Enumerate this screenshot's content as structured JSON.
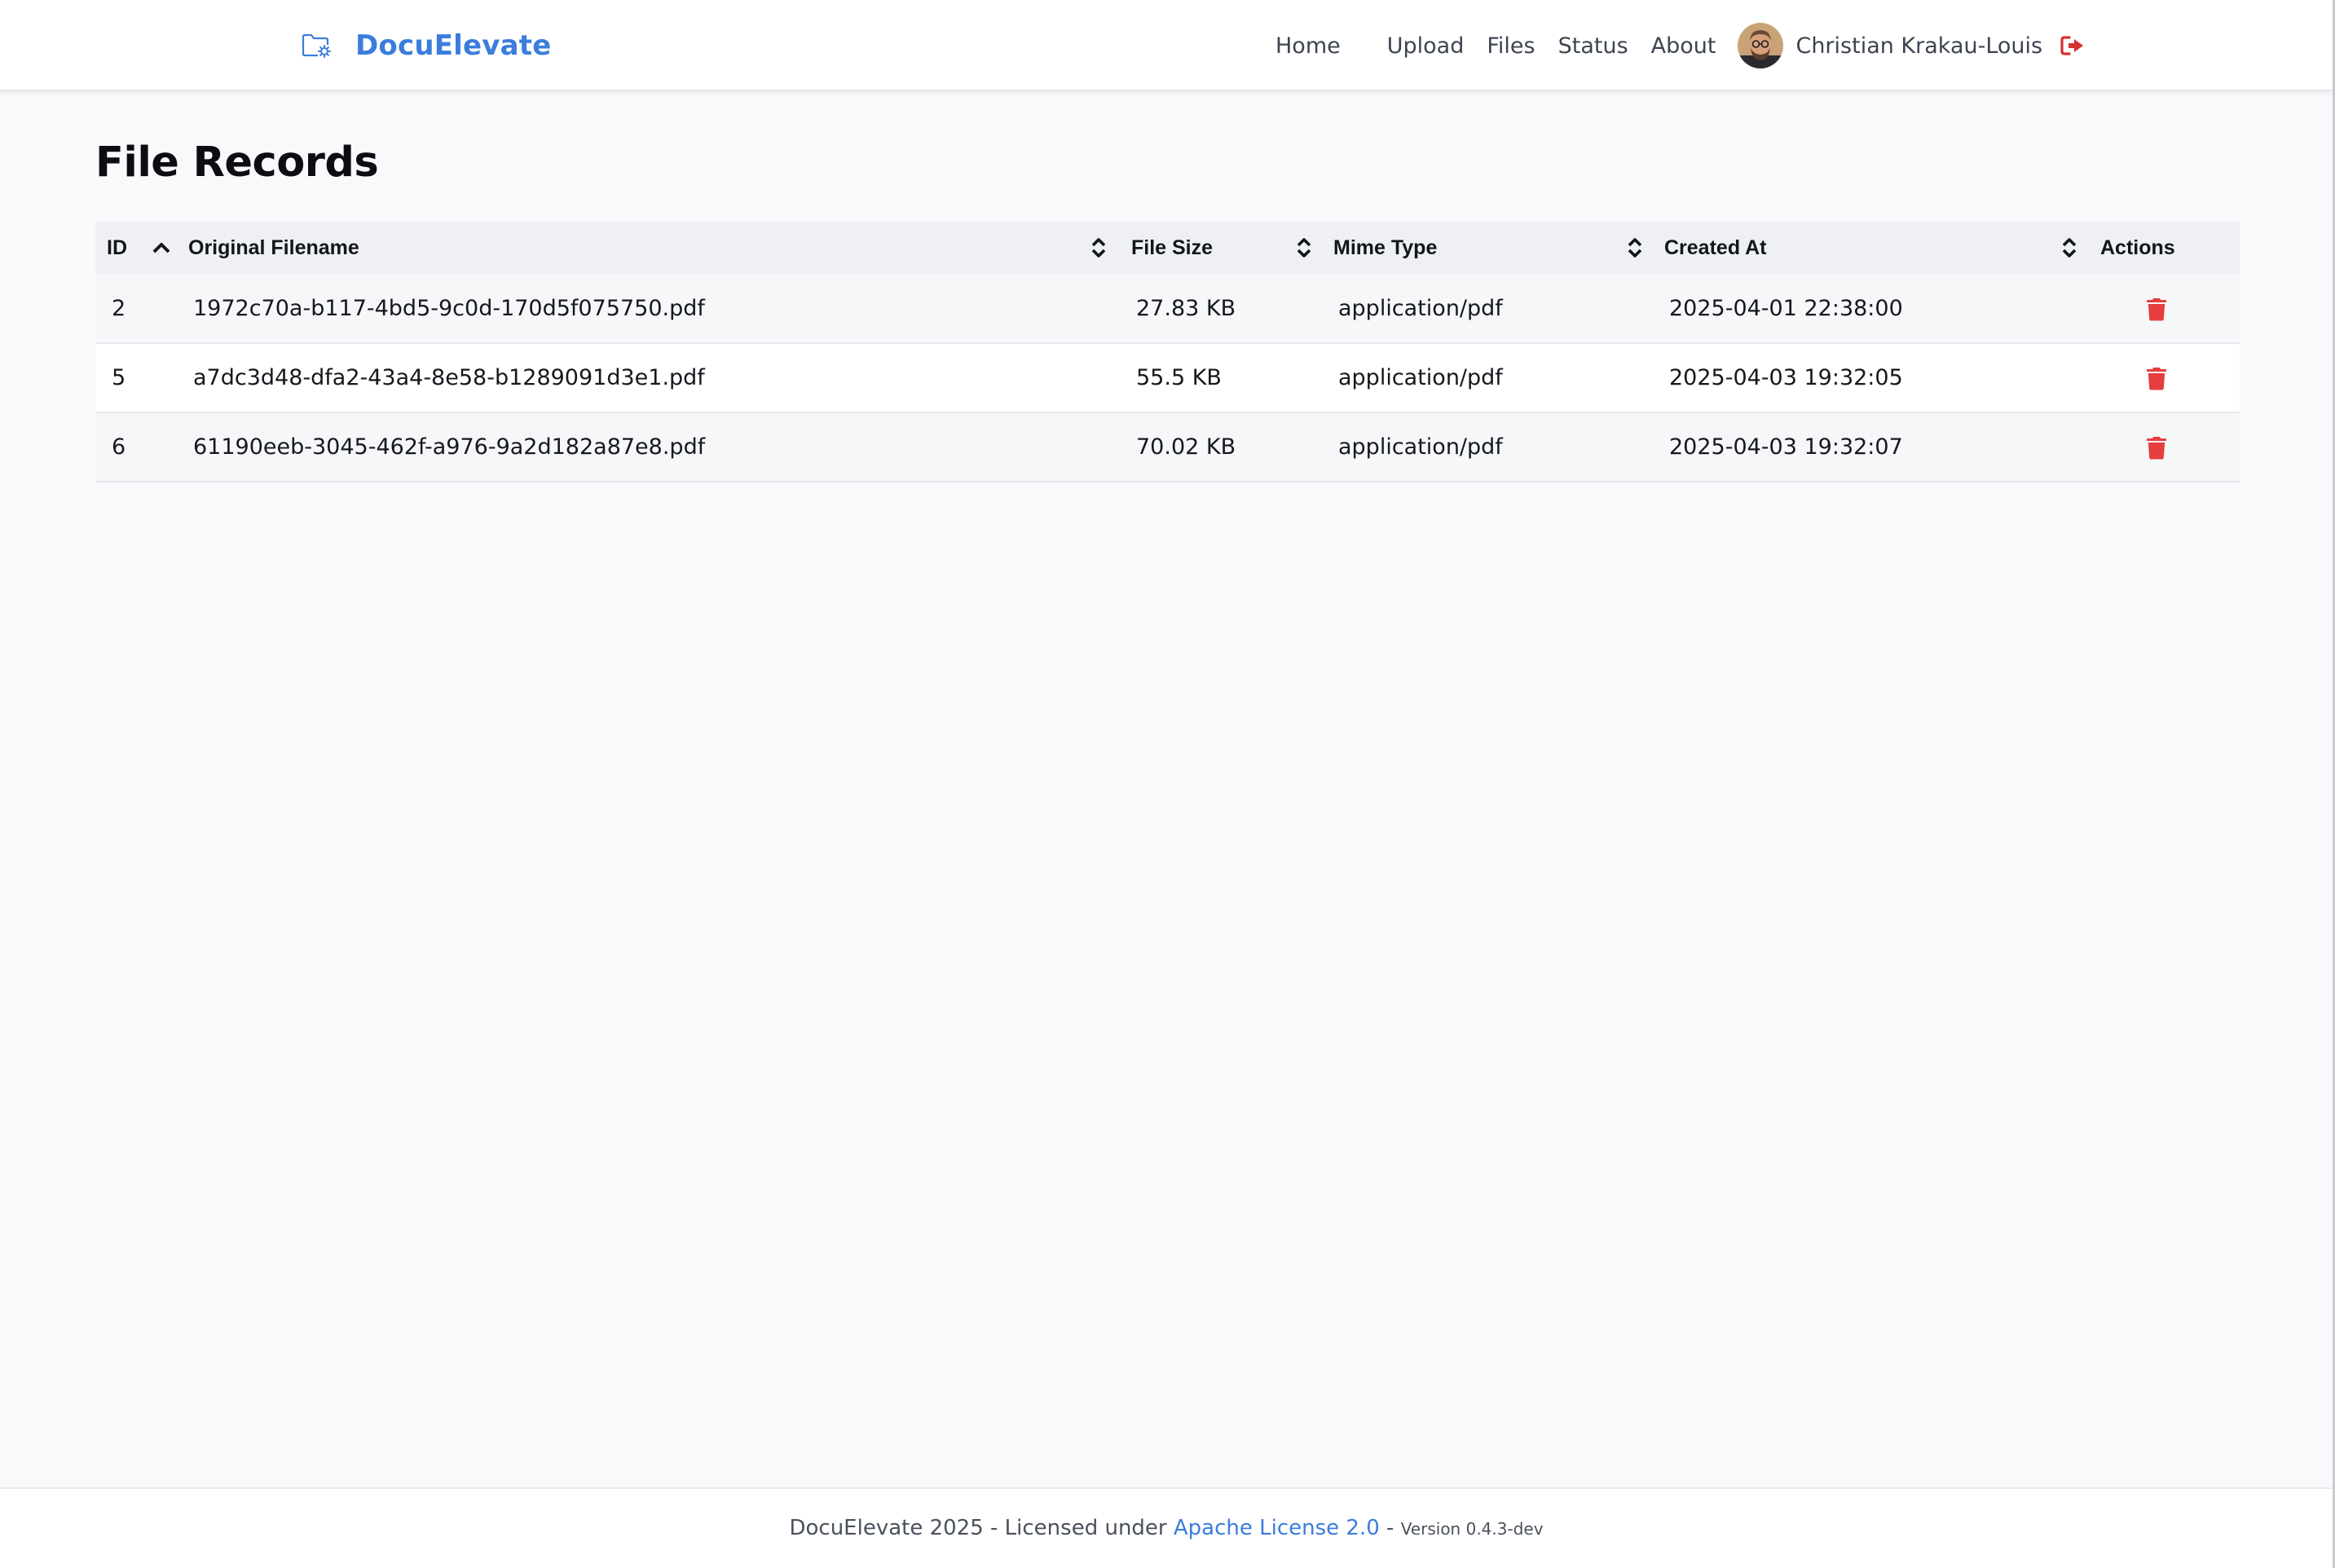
{
  "header": {
    "brand": "DocuElevate",
    "nav": {
      "home": "Home",
      "upload": "Upload",
      "files": "Files",
      "status": "Status",
      "about": "About"
    },
    "user": {
      "name": "Christian Krakau-Louis"
    }
  },
  "main": {
    "title": "File Records",
    "table": {
      "columns": {
        "id": "ID",
        "filename": "Original Filename",
        "size": "File Size",
        "mime": "Mime Type",
        "created": "Created At",
        "actions": "Actions"
      },
      "sorted_by": "id",
      "sort_direction": "ascending",
      "rows": [
        {
          "id": "2",
          "filename": "1972c70a-b117-4bd5-9c0d-170d5f075750.pdf",
          "size": "27.83 KB",
          "mime": "application/pdf",
          "created": "2025-04-01 22:38:00"
        },
        {
          "id": "5",
          "filename": "a7dc3d48-dfa2-43a4-8e58-b1289091d3e1.pdf",
          "size": "55.5 KB",
          "mime": "application/pdf",
          "created": "2025-04-03 19:32:05"
        },
        {
          "id": "6",
          "filename": "61190eeb-3045-462f-a976-9a2d182a87e8.pdf",
          "size": "70.02 KB",
          "mime": "application/pdf",
          "created": "2025-04-03 19:32:07"
        }
      ]
    }
  },
  "footer": {
    "prefix": "DocuElevate 2025 - Licensed under ",
    "license_link": "Apache License 2.0",
    "separator": " - ",
    "version": "Version 0.4.3-dev"
  },
  "colors": {
    "brand": "#3b7ddd",
    "danger": "#e53e3e",
    "background": "#f8f9fb",
    "header_row": "#eef0f3"
  },
  "icons": {
    "brand": "folder-cog-icon",
    "logout": "sign-out-icon",
    "sort_active": "sort-up-icon",
    "sort_inactive": "sort-icon",
    "delete": "trash-icon"
  }
}
